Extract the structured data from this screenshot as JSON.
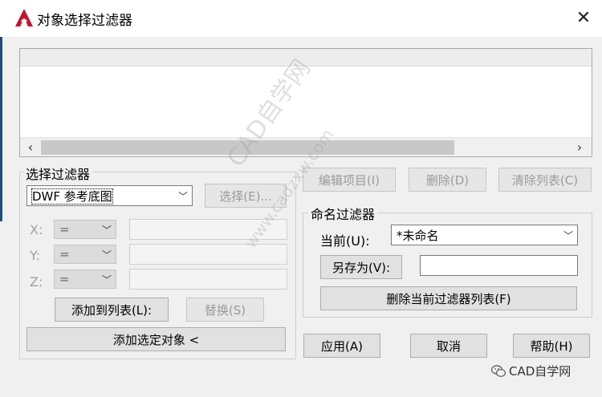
{
  "window": {
    "title": "对象选择过滤器",
    "close_glyph": "✕"
  },
  "colors": {
    "logo_red": "#c8102e",
    "dialog_bg": "#f0f0f0",
    "disabled_text": "#9a9a9a"
  },
  "list": {
    "scroll_left": "‹",
    "scroll_right": "›"
  },
  "select_filter": {
    "group_label": "选择过滤器",
    "type_value": "DWF 参考底图",
    "select_button": "选择(E)...",
    "x_label": "X:",
    "y_label": "Y:",
    "z_label": "Z:",
    "operator": "=",
    "add_to_list_button": "添加到列表(L):",
    "replace_button": "替换(S)",
    "add_selected_button": "添加选定对象 <"
  },
  "list_actions": {
    "edit_item_button": "编辑项目(I)",
    "delete_button": "删除(D)",
    "clear_list_button": "清除列表(C)"
  },
  "named_filter": {
    "group_label": "命名过滤器",
    "current_label": "当前(U):",
    "current_value": "*未命名",
    "save_as_button": "另存为(V):",
    "save_as_value": "",
    "delete_current_button": "删除当前过滤器列表(F)"
  },
  "footer": {
    "apply_button": "应用(A)",
    "cancel_button": "取消",
    "help_button": "帮助(H)"
  },
  "watermark": {
    "line1": "CAD自学网",
    "line2": "www.cadzxw.com",
    "brand": "CAD自学网"
  }
}
